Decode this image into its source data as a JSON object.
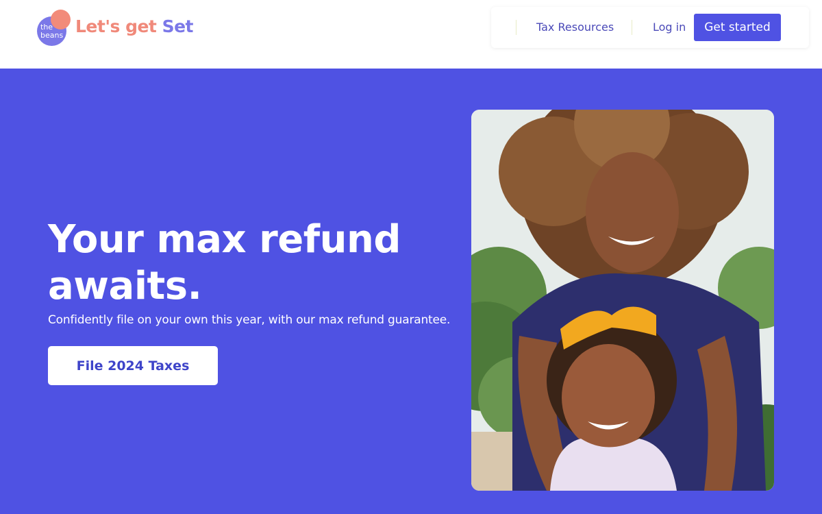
{
  "header": {
    "logo": {
      "mark_text": "the beans",
      "word_part1": "Let's get ",
      "word_part2": "Set"
    },
    "nav": {
      "tax_resources_label": "Tax Resources",
      "login_label": "Log in",
      "get_started_label": "Get started"
    }
  },
  "hero": {
    "title": "Your max refund awaits.",
    "subtitle": "Confidently file on your own this year, with our max refund guarantee.",
    "cta_label": "File 2024 Taxes",
    "photo_alt": "Smiling woman with curly hair and a young girl with a yellow bow"
  },
  "colors": {
    "brand_purple": "#4f52e3",
    "logo_pink": "#f0897a",
    "logo_purple": "#7b78e8",
    "nav_text": "#4a49b8"
  }
}
